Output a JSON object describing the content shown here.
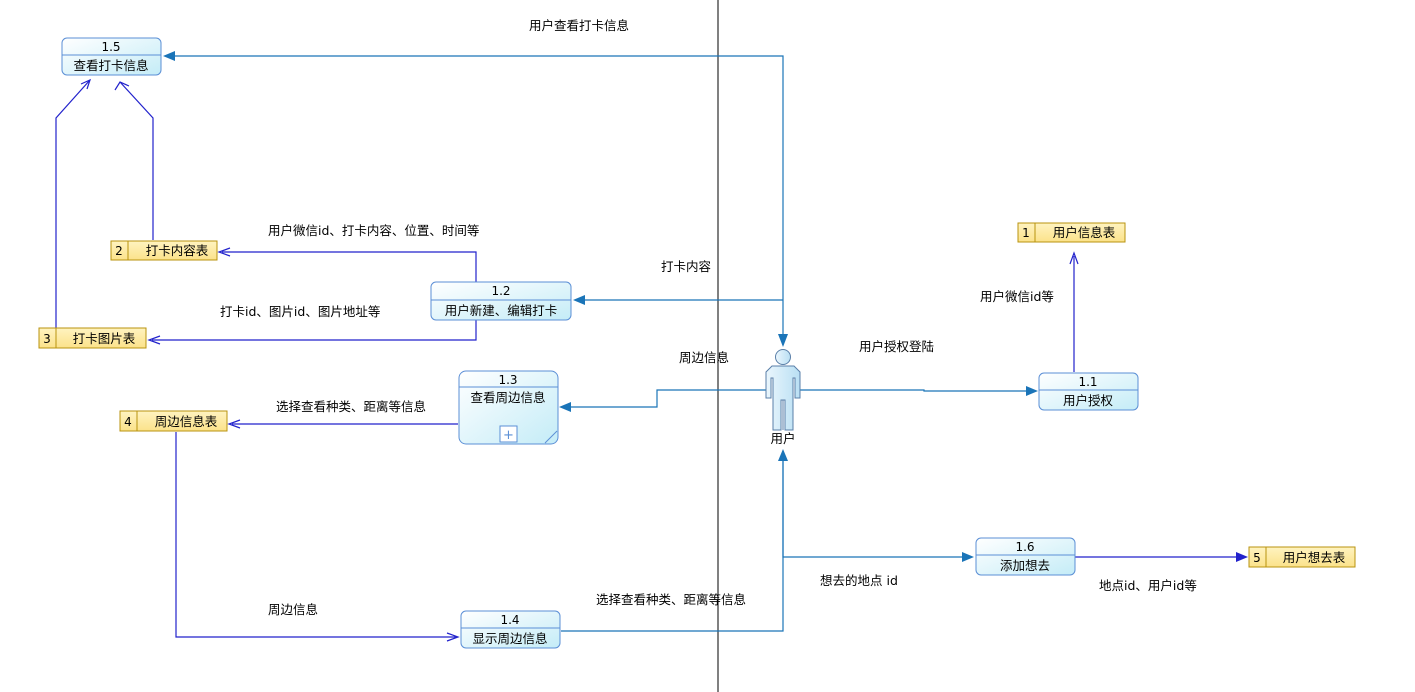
{
  "colors": {
    "process_fill_top": "#ffffff",
    "process_fill_bottom": "#c4ecf7",
    "process_stroke": "#5b8fd6",
    "store_fill": "#fde99b",
    "store_stroke": "#b8930f",
    "flow_blue": "#2222cc",
    "flow_teal": "#1a74b8",
    "actor_fill": "#cfe9f8",
    "actor_stroke": "#5a7fa8"
  },
  "actor": {
    "label": "用户",
    "icon": "user-icon"
  },
  "processes": {
    "p11": {
      "num": "1.1",
      "title": "用户授权"
    },
    "p12": {
      "num": "1.2",
      "title": "用户新建、编辑打卡"
    },
    "p13": {
      "num": "1.3",
      "title": "查看周边信息",
      "expand": "+"
    },
    "p14": {
      "num": "1.4",
      "title": "显示周边信息"
    },
    "p15": {
      "num": "1.5",
      "title": "查看打卡信息"
    },
    "p16": {
      "num": "1.6",
      "title": "添加想去"
    }
  },
  "stores": {
    "s1": {
      "num": "1",
      "name": "用户信息表"
    },
    "s2": {
      "num": "2",
      "name": "打卡内容表"
    },
    "s3": {
      "num": "3",
      "name": "打卡图片表"
    },
    "s4": {
      "num": "4",
      "name": "周边信息表"
    },
    "s5": {
      "num": "5",
      "name": "用户想去表"
    }
  },
  "flow_labels": {
    "view_checkin_info": "用户查看打卡信息",
    "wechat_checkin_fields": "用户微信id、打卡内容、位置、时间等",
    "checkin_content": "打卡内容",
    "image_fields": "打卡id、图片id、图片地址等",
    "nearby_info_top": "周边信息",
    "auth_login": "用户授权登陆",
    "user_wechat_id": "用户微信id等",
    "select_type_distance_top": "选择查看种类、距离等信息",
    "select_type_distance_bottom": "选择查看种类、距离等信息",
    "nearby_info_bottom": "周边信息",
    "wishlist_place_id": "想去的地点 id",
    "place_user_ids": "地点id、用户id等"
  }
}
